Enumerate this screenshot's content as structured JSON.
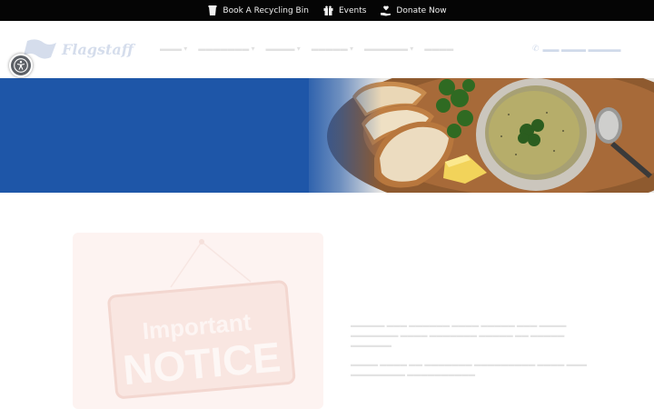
{
  "topbar": {
    "items": [
      {
        "label": "Book A Recycling Bin",
        "icon": "cup-icon"
      },
      {
        "label": "Events",
        "icon": "gift-icon"
      },
      {
        "label": "Donate Now",
        "icon": "hand-heart-icon"
      }
    ]
  },
  "header": {
    "logo_text": "Flagstaff"
  },
  "notice": {
    "line1": "Important",
    "line2": "NOTICE"
  },
  "colors": {
    "topbar_bg": "#050505",
    "hero_blue": "#1e56a8",
    "brand_blue": "#1b4a9a"
  }
}
